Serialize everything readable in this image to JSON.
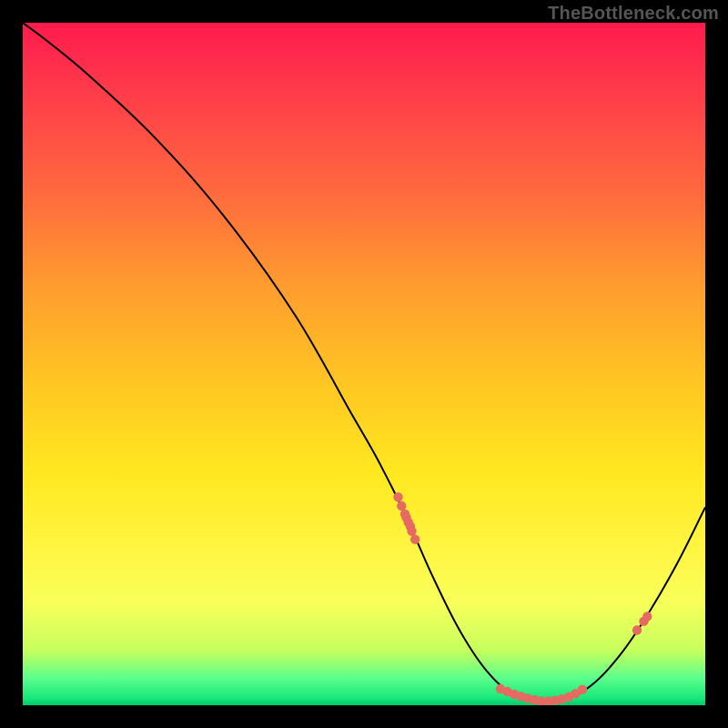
{
  "attribution": "TheBottleneck.com",
  "colors": {
    "gradient_top": "#ff1a4d",
    "gradient_mid": "#ffe81f",
    "gradient_bottom": "#00c86b",
    "curve": "#000000",
    "dots": "#e46a62",
    "background": "#000000"
  },
  "chart_data": {
    "type": "line",
    "title": "",
    "xlabel": "",
    "ylabel": "",
    "xlim": [
      0,
      100
    ],
    "ylim": [
      0,
      100
    ],
    "x": [
      0,
      4,
      10,
      20,
      30,
      40,
      48,
      52,
      56,
      60,
      64,
      68,
      72,
      76,
      80,
      84,
      88,
      92,
      96,
      100
    ],
    "y": [
      100,
      97,
      92,
      82.5,
      71,
      57,
      43,
      36,
      28,
      19,
      11,
      5,
      1.5,
      0.5,
      1,
      3.5,
      8,
      14,
      21,
      29
    ],
    "markers": {
      "x": [
        55,
        55.5,
        56,
        56.5,
        57,
        57.5,
        56.2,
        56.8,
        70,
        71,
        72,
        73,
        74,
        75,
        76,
        77,
        78,
        79,
        80,
        81,
        82,
        90,
        91,
        91.5
      ],
      "y": [
        30.5,
        29.2,
        28.0,
        26.8,
        25.5,
        24.3,
        27.5,
        26.2,
        2.4,
        2.0,
        1.6,
        1.3,
        1.0,
        0.8,
        0.6,
        0.6,
        0.7,
        0.9,
        1.2,
        1.7,
        2.3,
        11.0,
        12.3,
        13.0
      ]
    }
  }
}
